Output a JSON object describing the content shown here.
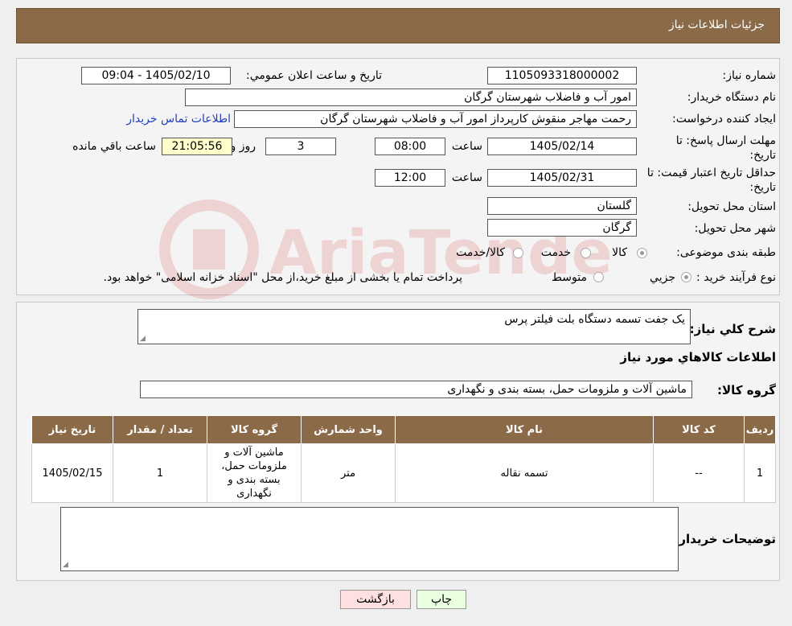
{
  "header": {
    "title": "جزئیات اطلاعات نیاز"
  },
  "form": {
    "need_number_label": "شماره نیاز:",
    "need_number": "1105093318000002",
    "announce_label": "تاریخ و ساعت اعلان عمومي:",
    "announce_value": "1405/02/10 - 09:04",
    "buyer_org_label": "نام دستگاه خريدار:",
    "buyer_org": "امور آب و فاضلاب شهرستان گرگان",
    "requester_label": "ايجاد کننده درخواست:",
    "requester": "رحمت مهاجر منقوش کارپرداز امور آب و فاضلاب شهرستان گرگان",
    "contact_link": "اطلاعات تماس خريدار",
    "deadline_label": "مهلت ارسال پاسخ: تا تاریخ:",
    "deadline_date": "1405/02/14",
    "time_label": "ساعت",
    "deadline_time": "08:00",
    "days": "3",
    "days_label": "روز و",
    "remaining": "21:05:56",
    "remaining_label": "ساعت باقي مانده",
    "validity_label": "حداقل تاریخ اعتبار قیمت: تا تاریخ:",
    "validity_date": "1405/02/31",
    "validity_time": "12:00",
    "province_label": "استان محل تحویل:",
    "province": "گلستان",
    "city_label": "شهر محل تحویل:",
    "city": "گرگان",
    "category_label": "طبقه بندی موضوعی:",
    "category_options": [
      "کالا",
      "خدمت",
      "کالا/خدمت"
    ],
    "process_label": "نوع فرآیند خرید :",
    "process_options": [
      "جزیي",
      "متوسط"
    ],
    "process_note": "پرداخت تمام یا بخشی از مبلغ خرید،از محل \"اسناد خزانه اسلامی\" خواهد بود."
  },
  "details": {
    "description_label": "شرح کلي نياز:",
    "description": "یک جفت تسمه دستگاه بلت فیلتر پرس",
    "goods_info_title": "اطلاعات کالاهاي مورد نياز",
    "goods_group_label": "گروه کالا:",
    "goods_group": "ماشین آلات و ملزومات حمل، بسته بندی و نگهداری",
    "table": {
      "headers": [
        "رديف",
        "کد کالا",
        "نام کالا",
        "واحد شمارش",
        "گروه کالا",
        "تعداد / مقدار",
        "تاریخ نیاز"
      ],
      "rows": [
        [
          "1",
          "--",
          "تسمه نقاله",
          "متر",
          "ماشین آلات و ملزومات حمل، بسته بندی و نگهداری",
          "1",
          "1405/02/15"
        ]
      ]
    },
    "buyer_notes_label": "توضیحات خریدار:",
    "buyer_notes": ""
  },
  "buttons": {
    "print": "چاپ",
    "back": "بازگشت"
  },
  "watermark": {
    "text": "AriaTender.neT"
  },
  "colors": {
    "header_bg": "#8b6a47",
    "link": "#2040c0",
    "back_btn": "#ffe0e0",
    "print_btn": "#e8ffe0"
  }
}
